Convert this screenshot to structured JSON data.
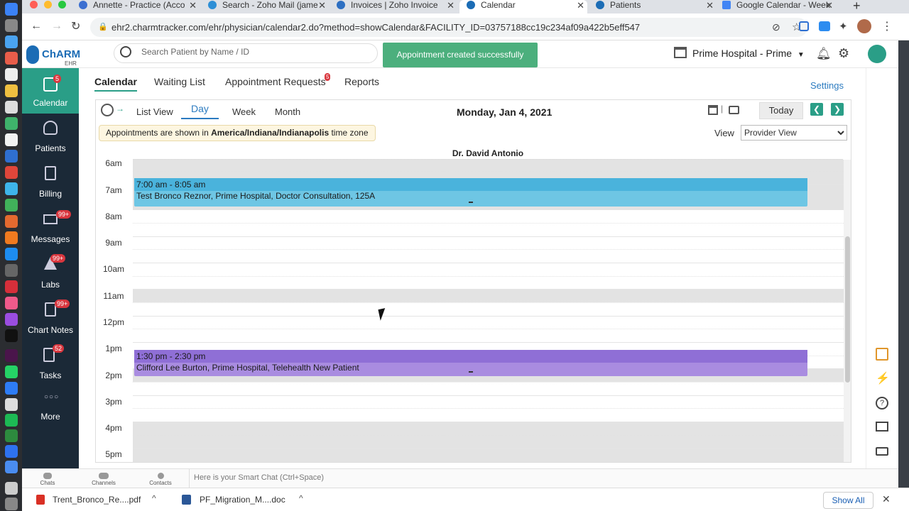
{
  "browser": {
    "tabs": [
      {
        "label": "Annette - Practice (Acco",
        "active": false
      },
      {
        "label": "Search - Zoho Mail (jame",
        "active": false
      },
      {
        "label": "Invoices | Zoho Invoice",
        "active": false
      },
      {
        "label": "Calendar",
        "active": true
      },
      {
        "label": "Patients",
        "active": false
      },
      {
        "label": "Google Calendar - Week",
        "active": false
      }
    ],
    "new_tab": "+",
    "url": "ehr2.charmtracker.com/ehr/physician/calendar2.do?method=showCalendar&FACILITY_ID=03757188cc19c234af09a422b5eff547"
  },
  "header": {
    "brand": "ChARM",
    "brand_sub": "EHR",
    "search_placeholder": "Search Patient by Name / ID",
    "toast": "Appointment created successfully",
    "facility": "Prime Hospital - Prime"
  },
  "leftnav": {
    "items": [
      {
        "label": "Calendar",
        "badge": "5",
        "icon": "calendar-icon"
      },
      {
        "label": "Patients",
        "badge": "",
        "icon": "patients-icon"
      },
      {
        "label": "Billing",
        "badge": "",
        "icon": "billing-icon"
      },
      {
        "label": "Messages",
        "badge": "99+",
        "icon": "messages-icon"
      },
      {
        "label": "Labs",
        "badge": "99+",
        "icon": "labs-icon"
      },
      {
        "label": "Chart Notes",
        "badge": "99+",
        "icon": "chart-notes-icon"
      },
      {
        "label": "Tasks",
        "badge": "52",
        "icon": "tasks-icon"
      },
      {
        "label": "More",
        "badge": "",
        "icon": "more-icon"
      }
    ]
  },
  "subtabs": {
    "calendar": "Calendar",
    "waiting_list": "Waiting List",
    "appointment_requests": "Appointment Requests",
    "appointment_requests_badge": "5",
    "reports": "Reports",
    "settings": "Settings"
  },
  "calendar": {
    "views": {
      "list": "List View",
      "day": "Day",
      "week": "Week",
      "month": "Month"
    },
    "date": "Monday, Jan 4, 2021",
    "today": "Today",
    "tz_prefix": "Appointments are shown in ",
    "tz_name": "America/Indiana/Indianapolis",
    "tz_suffix": " time zone",
    "view_label": "View",
    "view_selected": "Provider View",
    "provider": "Dr. David Antonio",
    "hours": [
      "6am",
      "7am",
      "8am",
      "9am",
      "10am",
      "11am",
      "12pm",
      "1pm",
      "2pm",
      "3pm",
      "4pm",
      "5pm"
    ],
    "appointments": [
      {
        "time": "7:00 am - 8:05 am",
        "desc": "Test Bronco Reznor, Prime Hospital, Doctor Consultation, 125A",
        "color": "#6ec6e4",
        "header_color": "#4ab3dc"
      },
      {
        "time": "1:30 pm - 2:30 pm",
        "desc": "Clifford Lee Burton, Prime Hospital, Telehealth New Patient",
        "color": "#a98ce0",
        "header_color": "#8f6fd6"
      }
    ]
  },
  "chatbar": {
    "chats": "Chats",
    "channels": "Channels",
    "contacts": "Contacts",
    "smart_chat": "Here is your Smart Chat (Ctrl+Space)"
  },
  "downloads": {
    "files": [
      "Trent_Bronco_Re....pdf",
      "PF_Migration_M....doc"
    ],
    "show_all": "Show All"
  },
  "colors": {
    "accent": "#2a9e87",
    "nav_bg": "#1b2937",
    "link": "#2b7bc0",
    "toast": "#4caf7d"
  }
}
